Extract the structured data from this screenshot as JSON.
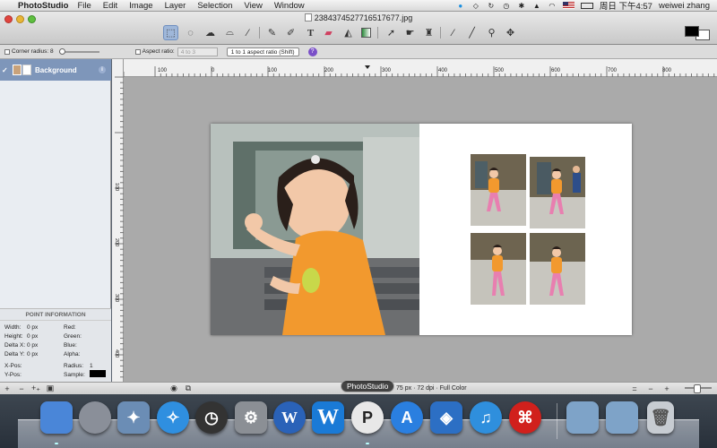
{
  "menubar": {
    "app_name": "PhotoStudio",
    "menus": [
      "File",
      "Edit",
      "Image",
      "Layer",
      "Selection",
      "View",
      "Window"
    ],
    "clock": "周日 下午4:57",
    "user": "weiwei zhang"
  },
  "window": {
    "title": "2384374527716517677.jpg"
  },
  "options": {
    "corner_radius_label": "Corner radius: 8",
    "aspect_ratio_label": "Aspect ratio:",
    "aspect_ratio_value": "4 to 3",
    "aspect_mode": "1 to 1 aspect ratio (Shift)",
    "help": "?"
  },
  "ruler_top": [
    "100",
    "0",
    "100",
    "200",
    "300",
    "400",
    "500",
    "600",
    "700",
    "800"
  ],
  "ruler_left": [
    "100",
    "200",
    "300",
    "400",
    "500"
  ],
  "layers": {
    "items": [
      {
        "name": "Background"
      }
    ]
  },
  "point_info": {
    "title": "POINT INFORMATION",
    "width_label": "Width:",
    "width_value": "0 px",
    "height_label": "Height:",
    "height_value": "0 px",
    "dx_label": "Delta X:",
    "dx_value": "0 px",
    "dy_label": "Delta Y:",
    "dy_value": "0 px",
    "xpos_label": "X-Pos:",
    "ypos_label": "Y-Pos:",
    "red_label": "Red:",
    "green_label": "Green:",
    "blue_label": "Blue:",
    "alpha_label": "Alpha:",
    "radius_label": "Radius:",
    "radius_value": "1",
    "sample_label": "Sample:"
  },
  "statusbar": {
    "doc_info": "75 px · 72 dpi · Full Color"
  },
  "dock": {
    "tooltip": "PhotoStudio",
    "colors": {
      "finder": "#4a86d8",
      "launchpad": "#8a8f99",
      "preview": "#6b8db5",
      "safari": "#2f8fe0",
      "dashboard": "#333333",
      "prefs": "#8b8f95",
      "word1": "#2a62b8",
      "word2": "#1a7ad6",
      "photostudio": "#e8e8e8",
      "appstore": "#2a7fe0",
      "dropbox": "#2c6fc4",
      "itunes": "#2f8fdd",
      "acrobat": "#d1201c",
      "folder": "#7ea3c8",
      "trash": "#c7ccd2"
    }
  }
}
